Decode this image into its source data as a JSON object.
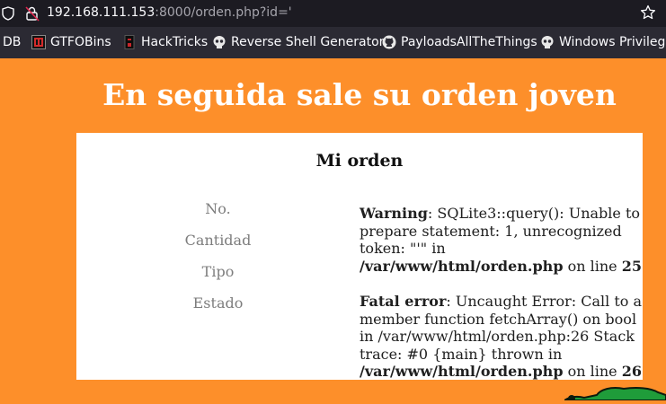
{
  "browser": {
    "url_host": "192.168.111.153",
    "url_rest": ":8000/orden.php?id='",
    "bookmarks": [
      {
        "label": "DB",
        "icon": "none"
      },
      {
        "label": "GTFOBins",
        "icon": "gtfobins-icon"
      },
      {
        "label": "HackTricks",
        "icon": "hacktricks-icon"
      },
      {
        "label": "Reverse Shell Generator",
        "icon": "skull-icon"
      },
      {
        "label": "PayloadsAllTheThings",
        "icon": "github-icon"
      },
      {
        "label": "Windows Privilege",
        "icon": "skull-icon"
      }
    ]
  },
  "page": {
    "heading": "En seguida sale su orden joven",
    "card_title": "Mi orden",
    "labels": [
      "No.",
      "Cantidad",
      "Tipo",
      "Estado"
    ],
    "warning": {
      "label": "Warning",
      "message": ": SQLite3::query(): Unable to prepare statement: 1, unrecognized token: \"'\" in ",
      "file": "/var/www/html/orden.php",
      "on_line": " on line ",
      "line": "25"
    },
    "fatal": {
      "label": "Fatal error",
      "message": ": Uncaught Error: Call to a member function fetchArray() on bool in /var/www/html/orden.php:26 Stack trace: #0 {main} thrown in ",
      "file": "/var/www/html/orden.php",
      "on_line": " on line ",
      "line": "26"
    }
  },
  "colors": {
    "page_background": "#fd8f2a",
    "url_bar": "#1c1b22",
    "bookmarks_bar": "#2b2a33",
    "label_gray": "#7d7d7d"
  }
}
